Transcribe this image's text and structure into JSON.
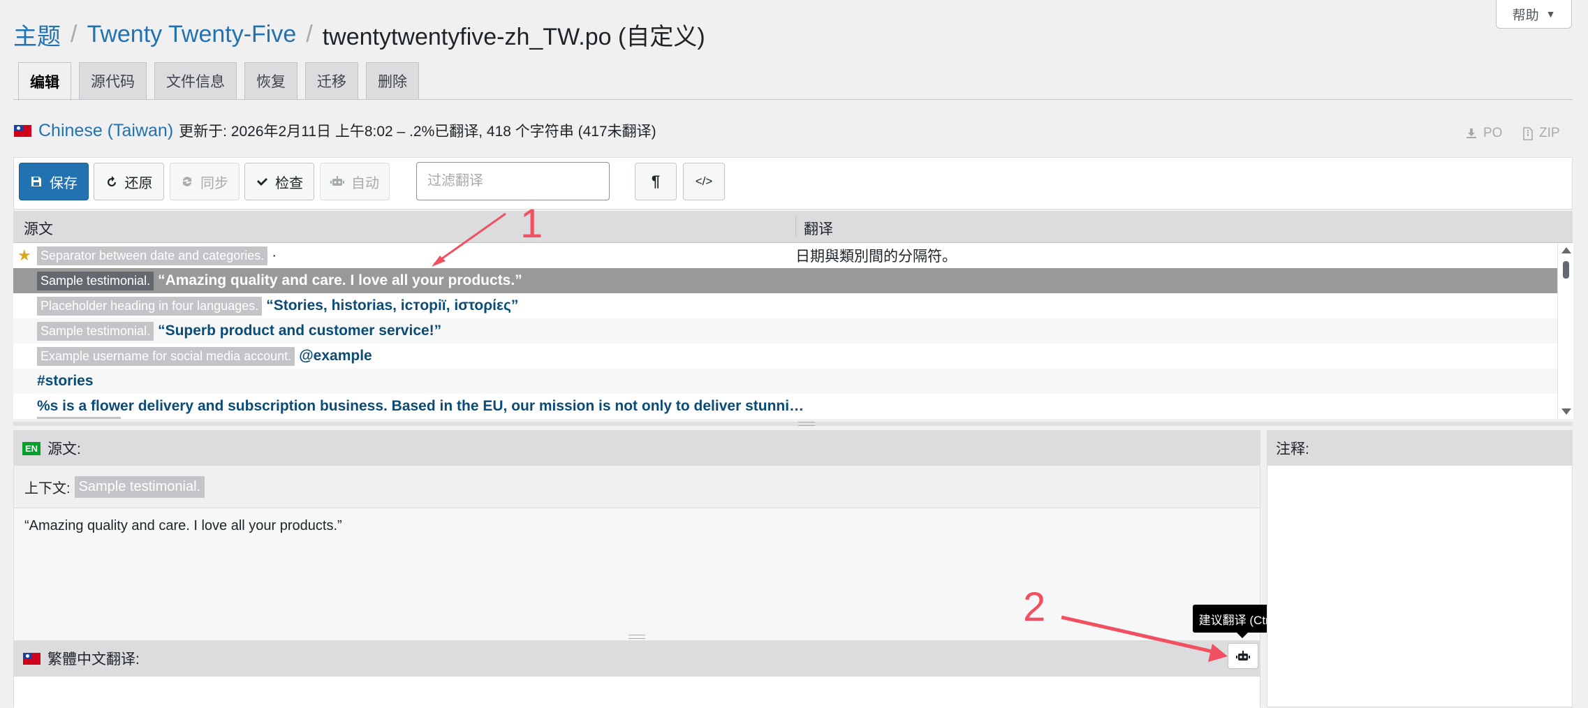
{
  "help": {
    "label": "帮助",
    "caret": "▼"
  },
  "breadcrumb": {
    "root": "主题",
    "theme": "Twenty Twenty-Five",
    "file": "twentytwentyfive-zh_TW.po (自定义)",
    "sep": "/"
  },
  "tabs": [
    {
      "label": "编辑",
      "active": true
    },
    {
      "label": "源代码"
    },
    {
      "label": "文件信息"
    },
    {
      "label": "恢复"
    },
    {
      "label": "迁移"
    },
    {
      "label": "删除"
    }
  ],
  "info": {
    "language": "Chinese (Taiwan)",
    "meta": "更新于: 2026年2月11日 上午8:02 – .2%已翻译, 418 个字符串 (417未翻译)"
  },
  "downloads": {
    "po": "PO",
    "zip": "ZIP"
  },
  "toolbar": {
    "save": "保存",
    "revert": "还原",
    "sync": "同步",
    "check": "检查",
    "auto": "自动",
    "filter_placeholder": "过滤翻译",
    "pilcrow": "¶",
    "code": "</>"
  },
  "list": {
    "col_source": "源文",
    "col_translation": "翻译",
    "rows": [
      {
        "context": "Separator between date and categories.",
        "source": "·",
        "translation": "日期與類別間的分隔符。",
        "starred": true
      },
      {
        "context": "Sample testimonial.",
        "source": "“Amazing quality and care. I love all your products.”",
        "translation": "",
        "selected": true
      },
      {
        "context": "Placeholder heading in four languages.",
        "source": "“Stories, historias, iсторії, iστορίες”",
        "translation": ""
      },
      {
        "context": "Sample testimonial.",
        "source": "“Superb product and customer service!”",
        "translation": ""
      },
      {
        "context": "Example username for social media account.",
        "source": "@example",
        "translation": ""
      },
      {
        "context": "",
        "source": "#stories",
        "translation": ""
      },
      {
        "context": "",
        "source": "%s is a flower delivery and subscription business. Based in the EU, our mission is not only to deliver stunni…",
        "translation": ""
      }
    ]
  },
  "source_panel": {
    "badge": "EN",
    "title": "源文:",
    "context_label": "上下文:",
    "context_value": "Sample testimonial.",
    "text": "“Amazing quality and care. I love all your products.”",
    "translation_label": "繁體中文翻译:"
  },
  "notes_panel": {
    "title": "注释:"
  },
  "tooltip": {
    "text": "建议翻译 (Ctrl-J)"
  },
  "annotations": {
    "one": "1",
    "two": "2"
  },
  "colors": {
    "accent": "#2271b1",
    "annotation": "#f0505f",
    "selected_row": "#999999"
  }
}
